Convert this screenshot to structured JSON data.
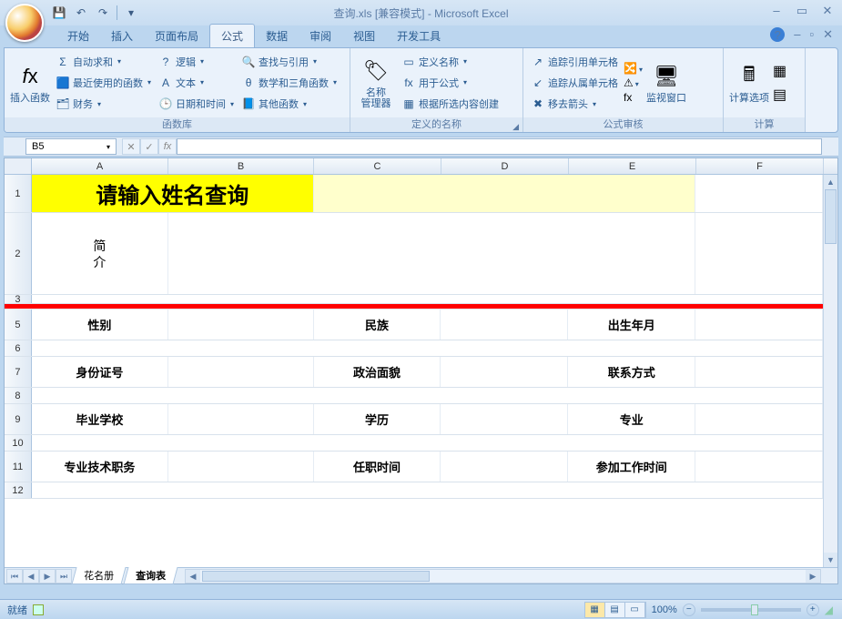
{
  "title": {
    "file": "查询.xls",
    "mode": "[兼容模式]",
    "app": "Microsoft Excel"
  },
  "tabs": [
    "开始",
    "插入",
    "页面布局",
    "公式",
    "数据",
    "审阅",
    "视图",
    "开发工具"
  ],
  "active_tab": "公式",
  "ribbon": {
    "g1": {
      "big": "插入函数",
      "items": [
        "自动求和",
        "最近使用的函数",
        "财务"
      ],
      "label": "函数库"
    },
    "g1b": {
      "items": [
        "逻辑",
        "文本",
        "日期和时间"
      ]
    },
    "g1c": {
      "items": [
        "查找与引用",
        "数学和三角函数",
        "其他函数"
      ]
    },
    "g2": {
      "big": "名称\n管理器",
      "items": [
        "定义名称",
        "用于公式",
        "根据所选内容创建"
      ],
      "label": "定义的名称"
    },
    "g3": {
      "items": [
        "追踪引用单元格",
        "追踪从属单元格",
        "移去箭头"
      ],
      "big": "监视窗口",
      "label": "公式审核"
    },
    "g4": {
      "big": "计算选项",
      "label": "计算"
    }
  },
  "namebox": "B5",
  "cols": [
    "A",
    "B",
    "C",
    "D",
    "E",
    "F"
  ],
  "rows": [
    "1",
    "2",
    "3",
    "5",
    "6",
    "7",
    "8",
    "9",
    "10",
    "11",
    "12"
  ],
  "cells": {
    "banner": "请输入姓名查询",
    "profile": "简\n介",
    "r5": {
      "A": "性别",
      "C": "民族",
      "E": "出生年月"
    },
    "r7": {
      "A": "身份证号",
      "C": "政治面貌",
      "E": "联系方式"
    },
    "r9": {
      "A": "毕业学校",
      "C": "学历",
      "E": "专业"
    },
    "r11": {
      "A": "专业技术职务",
      "C": "任职时间",
      "E": "参加工作时间"
    }
  },
  "sheets": [
    "花名册",
    "查询表"
  ],
  "active_sheet": "查询表",
  "status": {
    "ready": "就绪",
    "zoom": "100%"
  }
}
